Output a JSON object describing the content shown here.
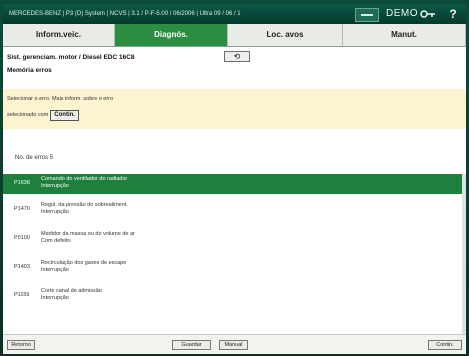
{
  "titlebar": {
    "title": "MERCEDES-BENZ | P3 (D) System | NCVS | 3.1 / P-F-5.00 / 06/2006  |  Ultra 09 / 06 / 1",
    "demo_label": "DEMO",
    "help_label": "?"
  },
  "tabs": [
    {
      "label": "Inform.veic."
    },
    {
      "label": "Diagnós."
    },
    {
      "label": "Loc. avos"
    },
    {
      "label": "Manut."
    }
  ],
  "header": {
    "system": "Sist. gerenciam. motor / Diesel EDC 16C8",
    "subtitle": "Memória erros",
    "back_icon": "⟲"
  },
  "info": {
    "line1": "Selecionar o erro. Mais inform. sobre o erro",
    "line2": "selecionado com",
    "contin_label": "Contin."
  },
  "count": "No. de erros 5",
  "errors": [
    {
      "code": "P1636",
      "line1": "Comando do ventilador do radiador",
      "line2": "Interrupção"
    },
    {
      "code": "P1470",
      "line1": "Regul. da pressão do sobrealiment.",
      "line2": "Interrupção"
    },
    {
      "code": "P0100",
      "line1": "Medidor da massa ou do volume de ar",
      "line2": "Com defeito"
    },
    {
      "code": "P1403",
      "line1": "Recirculação dos gases de escape",
      "line2": "Interrupção"
    },
    {
      "code": "P1159",
      "line1": "Corte canal de admissão",
      "line2": "Interrupção"
    }
  ],
  "footer": {
    "back_label": "Retorno",
    "save_label": "Guardar",
    "manual_label": "Manual",
    "contin_label": "Contin."
  },
  "colors": {
    "accent": "#2a8d3f",
    "selected_row": "#1f7f3c",
    "info_bg": "#fbf4cf"
  }
}
